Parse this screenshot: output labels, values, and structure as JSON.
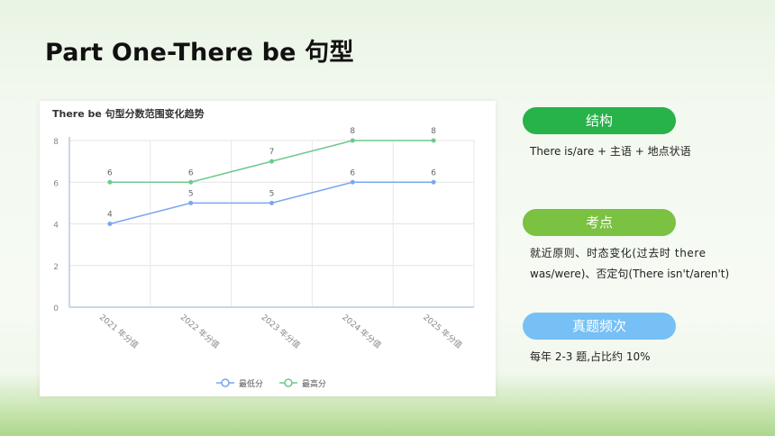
{
  "page": {
    "title": "Part One-There be 句型"
  },
  "colors": {
    "min_series": "#7aa7f0",
    "max_series": "#6fc98f",
    "pill_structure": "#27b24a",
    "pill_points": "#7bc142",
    "pill_frequency": "#76c0f5"
  },
  "sections": {
    "structure": {
      "label": "结构",
      "text": "There is/are + 主语 + 地点状语"
    },
    "points": {
      "label": "考点",
      "text_line1": "就近原则、时态变化(过去时 there",
      "text_line2": "was/were)、否定句(There isn't/aren't)"
    },
    "frequency": {
      "label": "真题频次",
      "text": "每年 2-3 题,占比约 10%"
    }
  },
  "chart_data": {
    "type": "line",
    "title": "There be 句型分数范围变化趋势",
    "categories": [
      "2021 年分值",
      "2022 年分值",
      "2023 年分值",
      "2024 年分值",
      "2025 年分值"
    ],
    "series": [
      {
        "name": "最低分",
        "values": [
          4,
          5,
          5,
          6,
          6
        ]
      },
      {
        "name": "最高分",
        "values": [
          6,
          6,
          7,
          8,
          8
        ]
      }
    ],
    "ylim": [
      0,
      8
    ],
    "yticks": [
      "0",
      "2",
      "4",
      "6",
      "8"
    ],
    "grid": true,
    "legend": "bottom",
    "data_labels": true
  }
}
